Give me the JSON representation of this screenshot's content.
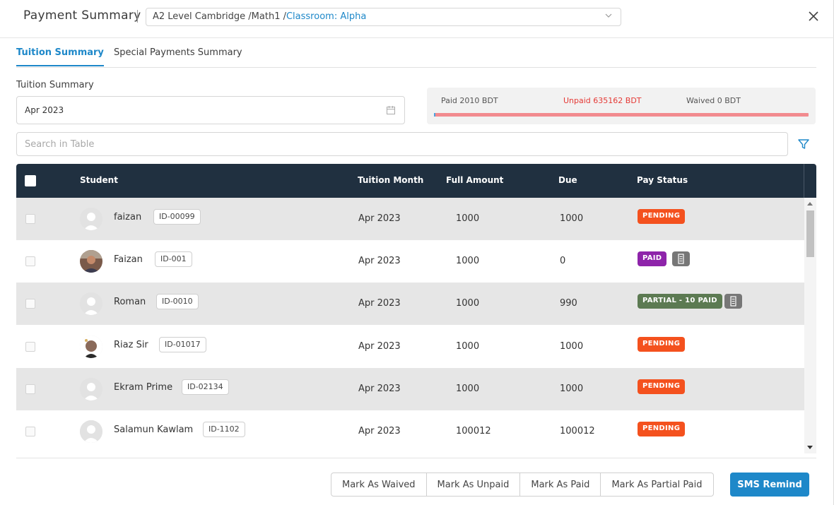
{
  "header": {
    "title": "Payment Summary",
    "class_path": "A2 Level Cambridge /Math1 /",
    "classroom": "Classroom: Alpha"
  },
  "tabs": [
    {
      "label": "Tuition Summary",
      "active": true
    },
    {
      "label": "Special Payments Summary",
      "active": false
    }
  ],
  "section_label": "Tuition Summary",
  "month_picker": {
    "value": "Apr 2023"
  },
  "summary": {
    "paid": "Paid 2010 BDT",
    "unpaid": "Unpaid 635162 BDT",
    "waived": "Waived 0 BDT",
    "paid_fraction": 0.003
  },
  "search": {
    "placeholder": "Search in Table"
  },
  "table": {
    "headers": {
      "student": "Student",
      "month": "Tuition Month",
      "full": "Full Amount",
      "due": "Due",
      "status": "Pay Status"
    },
    "rows": [
      {
        "name": "faizan",
        "id": "ID-00099",
        "month": "Apr 2023",
        "full": "1000",
        "due": "1000",
        "status": "PENDING"
      },
      {
        "name": "Faizan",
        "id": "ID-001",
        "month": "Apr 2023",
        "full": "1000",
        "due": "0",
        "status": "PAID"
      },
      {
        "name": "Roman",
        "id": "ID-0010",
        "month": "Apr 2023",
        "full": "1000",
        "due": "990",
        "status": "PARTIAL - 10 PAID"
      },
      {
        "name": "Riaz Sir",
        "id": "ID-01017",
        "month": "Apr 2023",
        "full": "1000",
        "due": "1000",
        "status": "PENDING"
      },
      {
        "name": "Ekram Prime",
        "id": "ID-02134",
        "month": "Apr 2023",
        "full": "1000",
        "due": "1000",
        "status": "PENDING"
      },
      {
        "name": "Salamun Kawlam",
        "id": "ID-1102",
        "month": "Apr 2023",
        "full": "100012",
        "due": "100012",
        "status": "PENDING"
      }
    ]
  },
  "actions": {
    "waived": "Mark As Waived",
    "unpaid": "Mark As Unpaid",
    "paid": "Mark As Paid",
    "partial": "Mark As Partial Paid",
    "sms": "SMS Remind"
  },
  "colors": {
    "accent": "#1e88c9",
    "table_header": "#203040",
    "pending": "#f4511e",
    "paid": "#8e24aa",
    "partial": "#5c7a52",
    "unpaid_text": "#e53935"
  }
}
